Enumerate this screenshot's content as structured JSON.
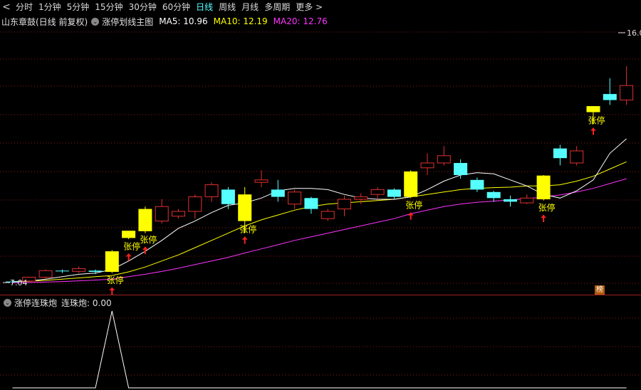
{
  "toolbar": {
    "back_glyph": "<",
    "periods": [
      "分时",
      "1分钟",
      "5分钟",
      "15分钟",
      "30分钟",
      "60分钟",
      "日线",
      "周线",
      "月线",
      "多周期",
      "更多"
    ],
    "active_period": "日线",
    "more_arrow": ">"
  },
  "info": {
    "stock": "山东章鼓(日线 前复权)",
    "indicator": "涨停划线主图",
    "ma5": "MA5: 10.96",
    "ma10": "MA10: 12.19",
    "ma20": "MA20: 12.76"
  },
  "sub": {
    "indicator": "涨停连珠炮",
    "value": "连珠炮: 0.00"
  },
  "labels": {
    "limit_up": "张停",
    "high": "16.0",
    "low": "7.04",
    "badge": "榜"
  },
  "colors": {
    "bg": "#000000",
    "grid": "#8a1a1a",
    "up": "#e03030",
    "down": "#55ffff",
    "limit": "#ffff00",
    "ma5": "#ffffff",
    "ma10": "#ffff00",
    "ma20": "#ff33ff",
    "arrow": "#ff2020",
    "toolbar_active": "#55ffff"
  },
  "candles": [
    {
      "o": 7.1,
      "h": 7.15,
      "l": 7.04,
      "c": 7.08,
      "lu": false
    },
    {
      "o": 7.12,
      "h": 7.3,
      "l": 7.1,
      "c": 7.28,
      "lu": false
    },
    {
      "o": 7.28,
      "h": 7.6,
      "l": 7.2,
      "c": 7.55,
      "lu": false
    },
    {
      "o": 7.55,
      "h": 7.6,
      "l": 7.45,
      "c": 7.52,
      "lu": false
    },
    {
      "o": 7.52,
      "h": 7.72,
      "l": 7.45,
      "c": 7.63,
      "lu": false
    },
    {
      "o": 7.55,
      "h": 7.6,
      "l": 7.4,
      "c": 7.5,
      "lu": false
    },
    {
      "o": 7.5,
      "h": 8.4,
      "l": 7.45,
      "c": 8.35,
      "lu": true
    },
    {
      "o": 8.9,
      "h": 9.2,
      "l": 8.85,
      "c": 9.2,
      "lu": true
    },
    {
      "o": 9.18,
      "h": 10.2,
      "l": 9.1,
      "c": 10.1,
      "lu": true
    },
    {
      "o": 9.6,
      "h": 10.5,
      "l": 9.5,
      "c": 10.2,
      "lu": false
    },
    {
      "o": 9.8,
      "h": 10.1,
      "l": 9.7,
      "c": 10.0,
      "lu": false
    },
    {
      "o": 10.0,
      "h": 10.7,
      "l": 9.7,
      "c": 10.6,
      "lu": false
    },
    {
      "o": 10.6,
      "h": 11.2,
      "l": 10.4,
      "c": 11.1,
      "lu": false
    },
    {
      "o": 10.9,
      "h": 11.0,
      "l": 10.1,
      "c": 10.3,
      "lu": false
    },
    {
      "o": 10.7,
      "h": 11.0,
      "l": 9.1,
      "c": 9.6,
      "lu": true
    },
    {
      "o": 11.2,
      "h": 11.7,
      "l": 11.0,
      "c": 11.3,
      "lu": false
    },
    {
      "o": 10.9,
      "h": 11.3,
      "l": 10.4,
      "c": 10.6,
      "lu": false
    },
    {
      "o": 10.3,
      "h": 10.9,
      "l": 10.1,
      "c": 10.8,
      "lu": false
    },
    {
      "o": 10.55,
      "h": 10.6,
      "l": 9.9,
      "c": 10.1,
      "lu": false
    },
    {
      "o": 9.7,
      "h": 10.1,
      "l": 9.6,
      "c": 10.0,
      "lu": false
    },
    {
      "o": 10.1,
      "h": 10.65,
      "l": 9.8,
      "c": 10.5,
      "lu": false
    },
    {
      "o": 10.5,
      "h": 10.75,
      "l": 10.3,
      "c": 10.6,
      "lu": false
    },
    {
      "o": 10.7,
      "h": 11.0,
      "l": 10.5,
      "c": 10.9,
      "lu": false
    },
    {
      "o": 10.9,
      "h": 10.95,
      "l": 10.5,
      "c": 10.6,
      "lu": false
    },
    {
      "o": 10.6,
      "h": 11.7,
      "l": 10.55,
      "c": 11.65,
      "lu": true
    },
    {
      "o": 11.8,
      "h": 12.4,
      "l": 11.5,
      "c": 12.0,
      "lu": false
    },
    {
      "o": 12.0,
      "h": 12.7,
      "l": 11.9,
      "c": 12.3,
      "lu": false
    },
    {
      "o": 12.0,
      "h": 12.15,
      "l": 11.35,
      "c": 11.5,
      "lu": false
    },
    {
      "o": 11.3,
      "h": 11.4,
      "l": 10.8,
      "c": 10.9,
      "lu": false
    },
    {
      "o": 10.8,
      "h": 10.85,
      "l": 10.4,
      "c": 10.55,
      "lu": false
    },
    {
      "o": 10.5,
      "h": 10.65,
      "l": 10.2,
      "c": 10.4,
      "lu": false
    },
    {
      "o": 10.35,
      "h": 10.7,
      "l": 10.3,
      "c": 10.55,
      "lu": false
    },
    {
      "o": 10.5,
      "h": 11.5,
      "l": 10.45,
      "c": 11.48,
      "lu": true
    },
    {
      "o": 12.6,
      "h": 12.75,
      "l": 11.9,
      "c": 12.2,
      "lu": false
    },
    {
      "o": 12.0,
      "h": 12.7,
      "l": 11.9,
      "c": 12.5,
      "lu": false
    },
    {
      "o": 14.1,
      "h": 14.35,
      "l": 13.6,
      "c": 14.35,
      "lu": true
    },
    {
      "o": 14.85,
      "h": 15.5,
      "l": 14.4,
      "c": 14.6,
      "lu": false
    },
    {
      "o": 14.6,
      "h": 16.0,
      "l": 14.4,
      "c": 15.2,
      "lu": false
    }
  ],
  "ma5": [
    7.1,
    7.12,
    7.2,
    7.3,
    7.4,
    7.45,
    7.6,
    7.95,
    8.35,
    8.8,
    9.3,
    9.6,
    9.95,
    10.25,
    10.35,
    10.55,
    10.85,
    10.95,
    10.95,
    10.9,
    10.7,
    10.55,
    10.5,
    10.5,
    10.6,
    10.9,
    11.25,
    11.5,
    11.6,
    11.55,
    11.3,
    11.05,
    10.7,
    10.55,
    10.85,
    11.3,
    12.4,
    13.0
  ],
  "ma10": [
    7.1,
    7.11,
    7.15,
    7.2,
    7.25,
    7.3,
    7.35,
    7.5,
    7.7,
    7.95,
    8.2,
    8.5,
    8.8,
    9.1,
    9.4,
    9.65,
    9.85,
    10.05,
    10.2,
    10.3,
    10.35,
    10.4,
    10.45,
    10.5,
    10.6,
    10.7,
    10.8,
    10.9,
    10.95,
    10.98,
    11.0,
    11.05,
    11.05,
    11.1,
    11.25,
    11.45,
    11.75,
    12.05
  ],
  "ma20": [
    7.05,
    7.06,
    7.08,
    7.1,
    7.13,
    7.16,
    7.2,
    7.3,
    7.4,
    7.52,
    7.65,
    7.8,
    7.95,
    8.1,
    8.28,
    8.45,
    8.62,
    8.8,
    8.95,
    9.1,
    9.25,
    9.4,
    9.55,
    9.7,
    9.9,
    10.05,
    10.2,
    10.3,
    10.38,
    10.42,
    10.48,
    10.52,
    10.6,
    10.68,
    10.8,
    10.95,
    11.15,
    11.35
  ],
  "sub_values": [
    0,
    0,
    0,
    0,
    0,
    0,
    1,
    0,
    0,
    0,
    0,
    0,
    0,
    0,
    0,
    0,
    0,
    0,
    0,
    0,
    0,
    0,
    0,
    0,
    0,
    0,
    0,
    0,
    0,
    0,
    0,
    0,
    0,
    0,
    0,
    0,
    0,
    0
  ]
}
